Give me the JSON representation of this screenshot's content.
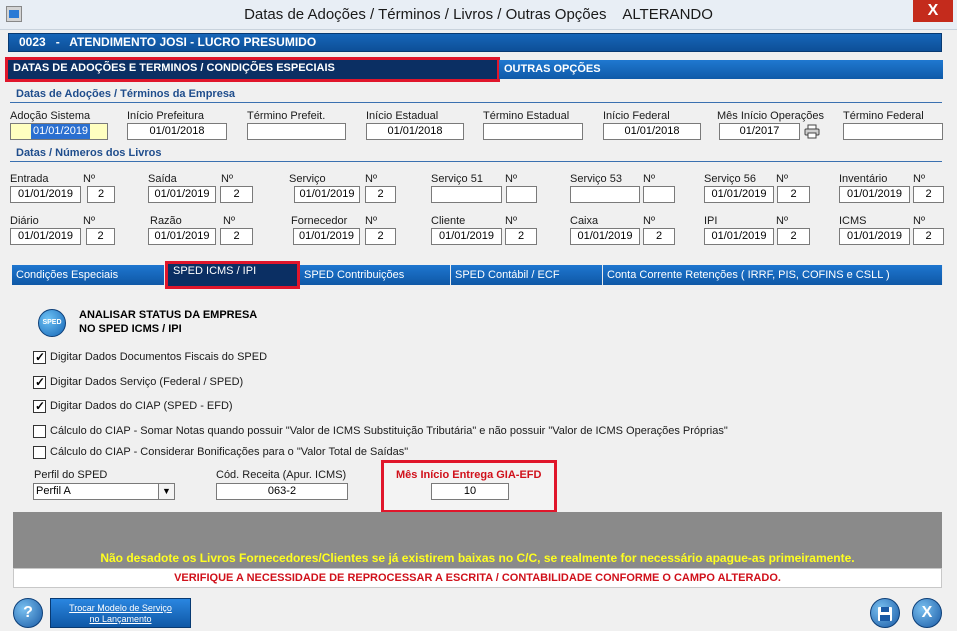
{
  "window": {
    "title": "Datas de Adoções / Términos / Livros / Outras Opções    ALTERANDO",
    "close_glyph": "X"
  },
  "company": {
    "label": "0023   -   ATENDIMENTO JOSI - LUCRO PRESUMIDO"
  },
  "top_tabs": {
    "datas": "DATAS DE ADOÇÕES E TERMINOS / CONDIÇÕES ESPECIAIS",
    "outras": "OUTRAS OPÇÕES"
  },
  "section_dates": {
    "title": "Datas de Adoções / Términos da Empresa",
    "fields": [
      {
        "label": "Adoção Sistema",
        "value": "01/01/2019"
      },
      {
        "label": "Início Prefeitura",
        "value": "01/01/2018"
      },
      {
        "label": "Término Prefeit.",
        "value": ""
      },
      {
        "label": "Início Estadual",
        "value": "01/01/2018"
      },
      {
        "label": "Término Estadual",
        "value": ""
      },
      {
        "label": "Início Federal",
        "value": "01/01/2018"
      },
      {
        "label": "Mês Início Operações",
        "value": "01/2017"
      },
      {
        "label": "Término Federal",
        "value": ""
      }
    ]
  },
  "section_books": {
    "title": "Datas / Números dos Livros",
    "row1": [
      {
        "label": "Entrada",
        "no_label": "Nº",
        "date": "01/01/2019",
        "num": "2"
      },
      {
        "label": "Saída",
        "no_label": "Nº",
        "date": "01/01/2019",
        "num": "2"
      },
      {
        "label": "Serviço",
        "no_label": "Nº",
        "date": "01/01/2019",
        "num": "2"
      },
      {
        "label": "Serviço 51",
        "no_label": "Nº",
        "date": "",
        "num": ""
      },
      {
        "label": "Serviço 53",
        "no_label": "Nº",
        "date": "",
        "num": ""
      },
      {
        "label": "Serviço 56",
        "no_label": "Nº",
        "date": "01/01/2019",
        "num": "2"
      },
      {
        "label": "Inventário",
        "no_label": "Nº",
        "date": "01/01/2019",
        "num": "2"
      }
    ],
    "row2": [
      {
        "label": "Diário",
        "no_label": "Nº",
        "date": "01/01/2019",
        "num": "2"
      },
      {
        "label": "Razão",
        "no_label": "Nº",
        "date": "01/01/2019",
        "num": "2"
      },
      {
        "label": "Fornecedor",
        "no_label": "Nº",
        "date": "01/01/2019",
        "num": "2"
      },
      {
        "label": "Cliente",
        "no_label": "Nº",
        "date": "01/01/2019",
        "num": "2"
      },
      {
        "label": "Caixa",
        "no_label": "Nº",
        "date": "01/01/2019",
        "num": "2"
      },
      {
        "label": "IPI",
        "no_label": "Nº",
        "date": "01/01/2019",
        "num": "2"
      },
      {
        "label": "ICMS",
        "no_label": "Nº",
        "date": "01/01/2019",
        "num": "2"
      }
    ]
  },
  "bottom_tabs": {
    "condicoes": "Condições Especiais",
    "icms": "SPED ICMS / IPI",
    "contrib": "SPED Contribuições",
    "contabil": "SPED Contábil / ECF",
    "conta": "Conta Corrente Retenções ( IRRF, PIS, COFINS  e  CSLL )"
  },
  "sped": {
    "icon_text": "SPED",
    "analisar_line1": "ANALISAR STATUS DA EMPRESA",
    "analisar_line2": "NO SPED ICMS / IPI",
    "checkboxes": [
      {
        "label": "Digitar Dados Documentos Fiscais do SPED",
        "checked": true
      },
      {
        "label": "Digitar Dados Serviço (Federal / SPED)",
        "checked": true
      },
      {
        "label": "Digitar Dados do CIAP (SPED - EFD)",
        "checked": true
      },
      {
        "label": "Cálculo do CIAP - Somar Notas quando possuir \"Valor de ICMS Substituição Tributária\" e não possuir \"Valor de ICMS Operações Próprias\"",
        "checked": false
      },
      {
        "label": "Cálculo do CIAP - Considerar Bonificações para o \"Valor Total de Saídas\"",
        "checked": false
      }
    ],
    "perfil_label": "Perfil do SPED",
    "perfil_value": "Perfil A",
    "cod_label": "Cód. Receita (Apur. ICMS)",
    "cod_value": "063-2",
    "gia_label": "Mês Início Entrega GIA-EFD",
    "gia_value": "10"
  },
  "messages": {
    "warn1": "Não desadote os Livros Fornecedores/Clientes se já existirem baixas no C/C, se realmente for necessário apague-as primeiramente.",
    "warn2": "VERIFIQUE A NECESSIDADE DE REPROCESSAR A ESCRITA / CONTABILIDADE CONFORME O CAMPO ALTERADO."
  },
  "footer": {
    "help_glyph": "?",
    "trocar_line1": "Trocar Modelo de Serviço",
    "trocar_line2": "no Lançamento",
    "exit_glyph": "X"
  }
}
